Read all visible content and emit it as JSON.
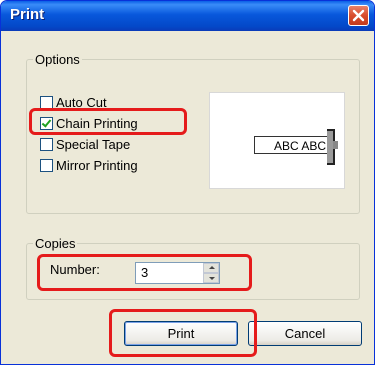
{
  "window": {
    "title": "Print"
  },
  "options": {
    "legend": "Options",
    "checkboxes": [
      {
        "label": "Auto Cut",
        "checked": false
      },
      {
        "label": "Chain Printing",
        "checked": true
      },
      {
        "label": "Special Tape",
        "checked": false
      },
      {
        "label": "Mirror Printing",
        "checked": false
      }
    ],
    "preview_text": "ABC ABC"
  },
  "copies": {
    "legend": "Copies",
    "number_label": "Number:",
    "number_value": "3"
  },
  "buttons": {
    "print": "Print",
    "cancel": "Cancel"
  },
  "colors": {
    "highlight": "#e51b1b",
    "titlebar": "#0858dc",
    "close": "#d94d2d"
  }
}
